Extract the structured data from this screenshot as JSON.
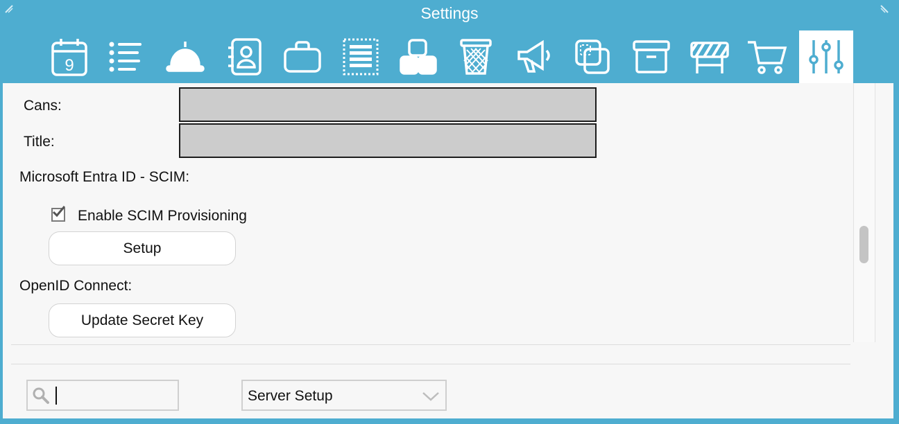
{
  "window": {
    "title": "Settings",
    "colors": {
      "frame": "#4eadd0",
      "panel": "#f7f7f7",
      "field": "#cccccc",
      "icon": "#ffffff",
      "active_icon": "#4eadd0"
    }
  },
  "toolbar": {
    "items": [
      {
        "name": "calendar-icon",
        "label": "9"
      },
      {
        "name": "list-icon"
      },
      {
        "name": "service-bell-icon"
      },
      {
        "name": "address-book-icon"
      },
      {
        "name": "briefcase-icon"
      },
      {
        "name": "document-lines-icon"
      },
      {
        "name": "blocks-icon"
      },
      {
        "name": "trash-bin-icon"
      },
      {
        "name": "megaphone-icon"
      },
      {
        "name": "copy-icon"
      },
      {
        "name": "archive-box-icon"
      },
      {
        "name": "barricade-icon"
      },
      {
        "name": "shopping-cart-icon"
      },
      {
        "name": "sliders-icon",
        "active": true
      }
    ]
  },
  "form": {
    "cans_label": "Cans:",
    "cans_value": "",
    "title_label": "Title:",
    "title_value": "",
    "scim_heading": "Microsoft Entra ID - SCIM:",
    "scim_checkbox_label": "Enable SCIM Provisioning",
    "scim_checkbox_checked": true,
    "setup_button": "Setup",
    "openid_heading": "OpenID Connect:",
    "update_key_button": "Update Secret Key"
  },
  "footer": {
    "search_value": "",
    "section_select": "Server Setup"
  }
}
